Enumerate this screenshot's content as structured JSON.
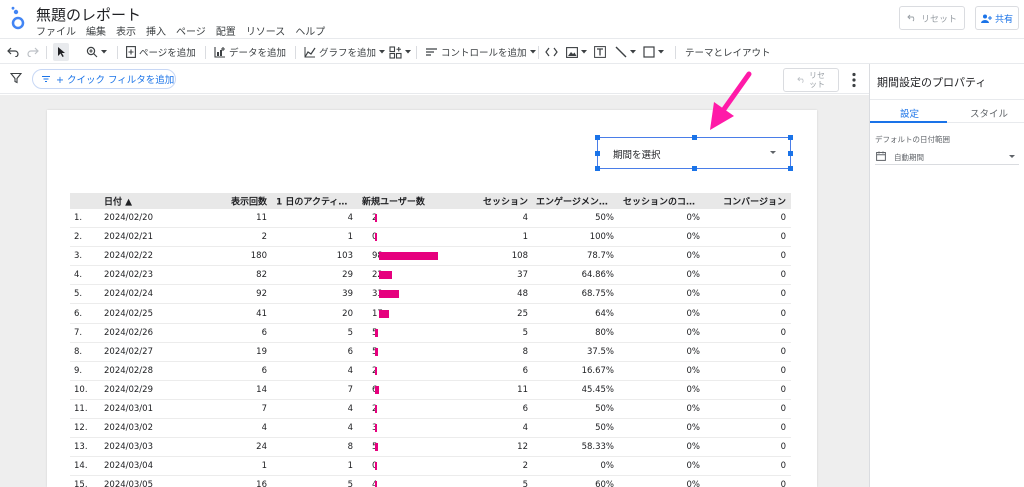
{
  "app": {
    "title": "無題のレポート",
    "menus": [
      "ファイル",
      "編集",
      "表示",
      "挿入",
      "ページ",
      "配置",
      "リソース",
      "ヘルプ"
    ],
    "reset_label": "リセット",
    "share_label": "共有"
  },
  "toolbar": {
    "add_page": "ページを追加",
    "add_data": "データを追加",
    "add_chart": "グラフを追加",
    "add_control": "コントロールを追加",
    "theme_layout": "テーマとレイアウト"
  },
  "filterbar": {
    "quick_filter": "+ クイック フィルタを追加",
    "reset_line1": "リセ",
    "reset_line2": "ット"
  },
  "date_control": {
    "label": "期間を選択"
  },
  "table": {
    "headers": [
      "日付 ▲",
      "表示回数",
      "1 日のアクティ…",
      "新規ユーザー数",
      "セッション",
      "エンゲージメン…",
      "セッションのコ…",
      "コンバージョン"
    ],
    "bar_max": 103,
    "rows": [
      {
        "n": "1.",
        "date": "2024/02/20",
        "views": "11",
        "active": "4",
        "new_users": 2,
        "sessions": "4",
        "engagement": "50%",
        "conv_rate": "0%",
        "conversions": "0"
      },
      {
        "n": "2.",
        "date": "2024/02/21",
        "views": "2",
        "active": "1",
        "new_users": 0,
        "sessions": "1",
        "engagement": "100%",
        "conv_rate": "0%",
        "conversions": "0"
      },
      {
        "n": "3.",
        "date": "2024/02/22",
        "views": "180",
        "active": "103",
        "new_users": 98,
        "sessions": "108",
        "engagement": "78.7%",
        "conv_rate": "0%",
        "conversions": "0"
      },
      {
        "n": "4.",
        "date": "2024/02/23",
        "views": "82",
        "active": "29",
        "new_users": 22,
        "sessions": "37",
        "engagement": "64.86%",
        "conv_rate": "0%",
        "conversions": "0"
      },
      {
        "n": "5.",
        "date": "2024/02/24",
        "views": "92",
        "active": "39",
        "new_users": 33,
        "sessions": "48",
        "engagement": "68.75%",
        "conv_rate": "0%",
        "conversions": "0"
      },
      {
        "n": "6.",
        "date": "2024/02/25",
        "views": "41",
        "active": "20",
        "new_users": 17,
        "sessions": "25",
        "engagement": "64%",
        "conv_rate": "0%",
        "conversions": "0"
      },
      {
        "n": "7.",
        "date": "2024/02/26",
        "views": "6",
        "active": "5",
        "new_users": 5,
        "sessions": "5",
        "engagement": "80%",
        "conv_rate": "0%",
        "conversions": "0"
      },
      {
        "n": "8.",
        "date": "2024/02/27",
        "views": "19",
        "active": "6",
        "new_users": 5,
        "sessions": "8",
        "engagement": "37.5%",
        "conv_rate": "0%",
        "conversions": "0"
      },
      {
        "n": "9.",
        "date": "2024/02/28",
        "views": "6",
        "active": "4",
        "new_users": 2,
        "sessions": "6",
        "engagement": "16.67%",
        "conv_rate": "0%",
        "conversions": "0"
      },
      {
        "n": "10.",
        "date": "2024/02/29",
        "views": "14",
        "active": "7",
        "new_users": 6,
        "sessions": "11",
        "engagement": "45.45%",
        "conv_rate": "0%",
        "conversions": "0"
      },
      {
        "n": "11.",
        "date": "2024/03/01",
        "views": "7",
        "active": "4",
        "new_users": 2,
        "sessions": "6",
        "engagement": "50%",
        "conv_rate": "0%",
        "conversions": "0"
      },
      {
        "n": "12.",
        "date": "2024/03/02",
        "views": "4",
        "active": "4",
        "new_users": 3,
        "sessions": "4",
        "engagement": "50%",
        "conv_rate": "0%",
        "conversions": "0"
      },
      {
        "n": "13.",
        "date": "2024/03/03",
        "views": "24",
        "active": "8",
        "new_users": 5,
        "sessions": "12",
        "engagement": "58.33%",
        "conv_rate": "0%",
        "conversions": "0"
      },
      {
        "n": "14.",
        "date": "2024/03/04",
        "views": "1",
        "active": "1",
        "new_users": 0,
        "sessions": "2",
        "engagement": "0%",
        "conv_rate": "0%",
        "conversions": "0"
      },
      {
        "n": "15.",
        "date": "2024/03/05",
        "views": "16",
        "active": "5",
        "new_users": 4,
        "sessions": "5",
        "engagement": "60%",
        "conv_rate": "0%",
        "conversions": "0"
      }
    ]
  },
  "panel": {
    "title": "期間設定のプロパティ",
    "tab_settings": "設定",
    "tab_style": "スタイル",
    "default_range_label": "デフォルトの日付範囲",
    "default_range_value": "自動期間"
  },
  "colors": {
    "bar": "#e6007e",
    "arrow": "#ff1aa8",
    "accent": "#1a73e8"
  }
}
